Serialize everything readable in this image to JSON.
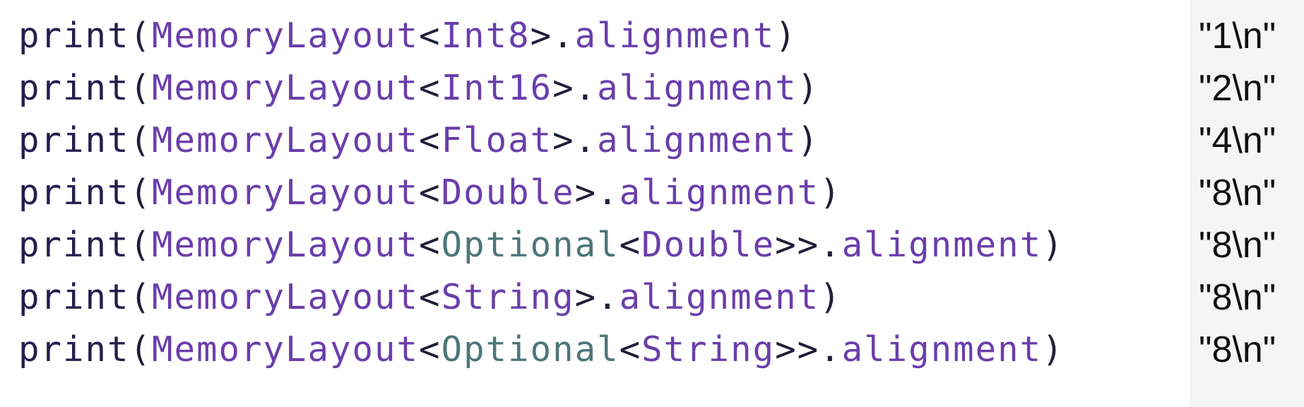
{
  "lines": [
    {
      "tokens": {
        "fn": "print",
        "open": "(",
        "type": "MemoryLayout",
        "lt": "<",
        "arg": "Int8",
        "gt": ">",
        "dot": ".",
        "prop": "alignment",
        "close": ")"
      },
      "result": "\"1\\n\""
    },
    {
      "tokens": {
        "fn": "print",
        "open": "(",
        "type": "MemoryLayout",
        "lt": "<",
        "arg": "Int16",
        "gt": ">",
        "dot": ".",
        "prop": "alignment",
        "close": ")"
      },
      "result": "\"2\\n\""
    },
    {
      "tokens": {
        "fn": "print",
        "open": "(",
        "type": "MemoryLayout",
        "lt": "<",
        "arg": "Float",
        "gt": ">",
        "dot": ".",
        "prop": "alignment",
        "close": ")"
      },
      "result": "\"4\\n\""
    },
    {
      "tokens": {
        "fn": "print",
        "open": "(",
        "type": "MemoryLayout",
        "lt": "<",
        "arg": "Double",
        "gt": ">",
        "dot": ".",
        "prop": "alignment",
        "close": ")"
      },
      "result": "\"8\\n\""
    },
    {
      "tokens": {
        "fn": "print",
        "open": "(",
        "type": "MemoryLayout",
        "lt": "<",
        "wrapper": "Optional",
        "lt2": "<",
        "arg": "Double",
        "gt2": ">",
        "gt": ">",
        "dot": ".",
        "prop": "alignment",
        "close": ")"
      },
      "result": "\"8\\n\""
    },
    {
      "tokens": {
        "fn": "print",
        "open": "(",
        "type": "MemoryLayout",
        "lt": "<",
        "arg": "String",
        "gt": ">",
        "dot": ".",
        "prop": "alignment",
        "close": ")"
      },
      "result": "\"8\\n\""
    },
    {
      "tokens": {
        "fn": "print",
        "open": "(",
        "type": "MemoryLayout",
        "lt": "<",
        "wrapper": "Optional",
        "lt2": "<",
        "arg": "String",
        "gt2": ">",
        "gt": ">",
        "dot": ".",
        "prop": "alignment",
        "close": ")"
      },
      "result": "\"8\\n\""
    }
  ],
  "colors": {
    "keyword": "#241e4e",
    "type": "#6a3eab",
    "generic": "#4d7678",
    "punct": "#1f1f3a",
    "results_bg": "#f5f5f5"
  }
}
